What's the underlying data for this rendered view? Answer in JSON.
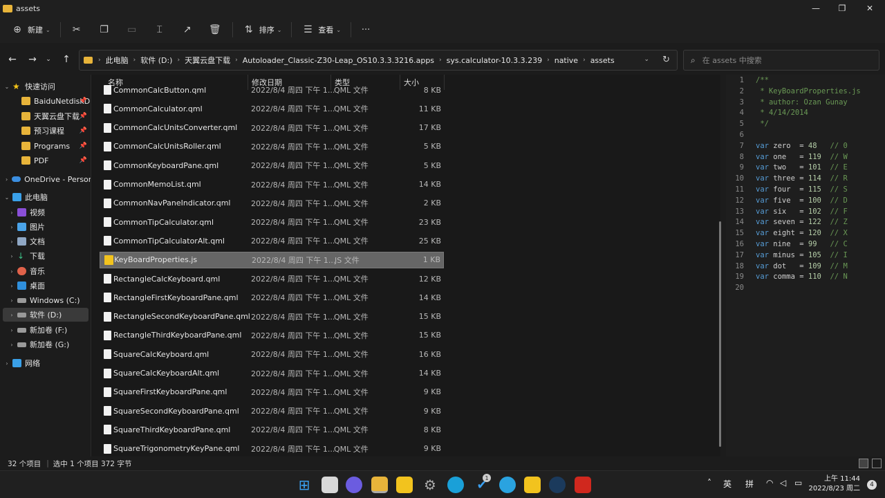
{
  "window": {
    "title": "assets",
    "minimize": "—",
    "maximize": "❐",
    "close": "✕"
  },
  "toolbar": {
    "new_label": "新建",
    "sort_label": "排序",
    "view_label": "查看",
    "more": "···"
  },
  "address": {
    "crumbs": [
      "此电脑",
      "软件 (D:)",
      "天翼云盘下载",
      "Autoloader_Classic-Z30-Leap_OS10.3.3.3216.apps",
      "sys.calculator-10.3.3.239",
      "native",
      "assets"
    ]
  },
  "search": {
    "placeholder": "在 assets 中搜索"
  },
  "sidebar": {
    "items": [
      {
        "label": "快速访问",
        "icon": "star-icon"
      },
      {
        "label": "BaiduNetdiskD",
        "icon": "folder-icon",
        "pinned": true
      },
      {
        "label": "天翼云盘下载",
        "icon": "folder-icon",
        "pinned": true
      },
      {
        "label": "预习课程",
        "icon": "folder-icon",
        "pinned": true
      },
      {
        "label": "Programs",
        "icon": "folder-icon",
        "pinned": true
      },
      {
        "label": "PDF",
        "icon": "folder-icon",
        "pinned": true
      },
      {
        "label": "OneDrive - Persona",
        "icon": "cloud-icon"
      },
      {
        "label": "此电脑",
        "icon": "pc-icon"
      },
      {
        "label": "视频",
        "icon": "video-icon"
      },
      {
        "label": "图片",
        "icon": "picture-icon"
      },
      {
        "label": "文档",
        "icon": "document-icon"
      },
      {
        "label": "下载",
        "icon": "download-icon"
      },
      {
        "label": "音乐",
        "icon": "music-icon"
      },
      {
        "label": "桌面",
        "icon": "desktop-icon"
      },
      {
        "label": "Windows (C:)",
        "icon": "drive-icon"
      },
      {
        "label": "软件 (D:)",
        "icon": "drive-icon",
        "selected": true
      },
      {
        "label": "新加卷 (F:)",
        "icon": "drive-icon"
      },
      {
        "label": "新加卷 (G:)",
        "icon": "drive-icon"
      },
      {
        "label": "网络",
        "icon": "network-icon"
      }
    ]
  },
  "columns": {
    "name": "名称",
    "date": "修改日期",
    "type": "类型",
    "size": "大小"
  },
  "files": [
    {
      "name": "CommonCalcButton.qml",
      "date": "2022/8/4 周四 下午 1...",
      "type": "QML 文件",
      "size": "8 KB"
    },
    {
      "name": "CommonCalculator.qml",
      "date": "2022/8/4 周四 下午 1...",
      "type": "QML 文件",
      "size": "11 KB"
    },
    {
      "name": "CommonCalcUnitsConverter.qml",
      "date": "2022/8/4 周四 下午 1...",
      "type": "QML 文件",
      "size": "17 KB"
    },
    {
      "name": "CommonCalcUnitsRoller.qml",
      "date": "2022/8/4 周四 下午 1...",
      "type": "QML 文件",
      "size": "5 KB"
    },
    {
      "name": "CommonKeyboardPane.qml",
      "date": "2022/8/4 周四 下午 1...",
      "type": "QML 文件",
      "size": "5 KB"
    },
    {
      "name": "CommonMemoList.qml",
      "date": "2022/8/4 周四 下午 1...",
      "type": "QML 文件",
      "size": "14 KB"
    },
    {
      "name": "CommonNavPaneIndicator.qml",
      "date": "2022/8/4 周四 下午 1...",
      "type": "QML 文件",
      "size": "2 KB"
    },
    {
      "name": "CommonTipCalculator.qml",
      "date": "2022/8/4 周四 下午 1...",
      "type": "QML 文件",
      "size": "23 KB"
    },
    {
      "name": "CommonTipCalculatorAlt.qml",
      "date": "2022/8/4 周四 下午 1...",
      "type": "QML 文件",
      "size": "25 KB"
    },
    {
      "name": "KeyBoardProperties.js",
      "date": "2022/8/4 周四 下午 1...",
      "type": "JS 文件",
      "size": "1 KB",
      "selected": true,
      "kind": "js"
    },
    {
      "name": "RectangleCalcKeyboard.qml",
      "date": "2022/8/4 周四 下午 1...",
      "type": "QML 文件",
      "size": "12 KB"
    },
    {
      "name": "RectangleFirstKeyboardPane.qml",
      "date": "2022/8/4 周四 下午 1...",
      "type": "QML 文件",
      "size": "14 KB"
    },
    {
      "name": "RectangleSecondKeyboardPane.qml",
      "date": "2022/8/4 周四 下午 1...",
      "type": "QML 文件",
      "size": "15 KB"
    },
    {
      "name": "RectangleThirdKeyboardPane.qml",
      "date": "2022/8/4 周四 下午 1...",
      "type": "QML 文件",
      "size": "15 KB"
    },
    {
      "name": "SquareCalcKeyboard.qml",
      "date": "2022/8/4 周四 下午 1...",
      "type": "QML 文件",
      "size": "16 KB"
    },
    {
      "name": "SquareCalcKeyboardAlt.qml",
      "date": "2022/8/4 周四 下午 1...",
      "type": "QML 文件",
      "size": "14 KB"
    },
    {
      "name": "SquareFirstKeyboardPane.qml",
      "date": "2022/8/4 周四 下午 1...",
      "type": "QML 文件",
      "size": "9 KB"
    },
    {
      "name": "SquareSecondKeyboardPane.qml",
      "date": "2022/8/4 周四 下午 1...",
      "type": "QML 文件",
      "size": "9 KB"
    },
    {
      "name": "SquareThirdKeyboardPane.qml",
      "date": "2022/8/4 周四 下午 1...",
      "type": "QML 文件",
      "size": "8 KB"
    },
    {
      "name": "SquareTrigonometryKeyPane.qml",
      "date": "2022/8/4 周四 下午 1...",
      "type": "QML 文件",
      "size": "9 KB"
    }
  ],
  "preview": {
    "lines": [
      {
        "n": "1",
        "t": "/**",
        "c": "cm"
      },
      {
        "n": "2",
        "t": " * KeyBoardProperties.js",
        "c": "cm"
      },
      {
        "n": "3",
        "t": " * author: Ozan Gunay",
        "c": "cm"
      },
      {
        "n": "4",
        "t": " * 4/14/2014",
        "c": "cm"
      },
      {
        "n": "5",
        "t": " */",
        "c": "cm"
      },
      {
        "n": "6",
        "t": "",
        "c": ""
      },
      {
        "n": "7",
        "kw": "var",
        "name": " zero  = ",
        "num": "48",
        "cm": "   // 0"
      },
      {
        "n": "8",
        "kw": "var",
        "name": " one   = ",
        "num": "119",
        "cm": "  // W"
      },
      {
        "n": "9",
        "kw": "var",
        "name": " two   = ",
        "num": "101",
        "cm": "  // E"
      },
      {
        "n": "10",
        "kw": "var",
        "name": " three = ",
        "num": "114",
        "cm": "  // R"
      },
      {
        "n": "11",
        "kw": "var",
        "name": " four  = ",
        "num": "115",
        "cm": "  // S"
      },
      {
        "n": "12",
        "kw": "var",
        "name": " five  = ",
        "num": "100",
        "cm": "  // D"
      },
      {
        "n": "13",
        "kw": "var",
        "name": " six   = ",
        "num": "102",
        "cm": "  // F"
      },
      {
        "n": "14",
        "kw": "var",
        "name": " seven = ",
        "num": "122",
        "cm": "  // Z"
      },
      {
        "n": "15",
        "kw": "var",
        "name": " eight = ",
        "num": "120",
        "cm": "  // X"
      },
      {
        "n": "16",
        "kw": "var",
        "name": " nine  = ",
        "num": "99",
        "cm": "   // C"
      },
      {
        "n": "17",
        "kw": "var",
        "name": " minus = ",
        "num": "105",
        "cm": "  // I"
      },
      {
        "n": "18",
        "kw": "var",
        "name": " dot   = ",
        "num": "109",
        "cm": "  // M"
      },
      {
        "n": "19",
        "kw": "var",
        "name": " comma = ",
        "num": "110",
        "cm": "  // N"
      },
      {
        "n": "20",
        "t": "",
        "c": ""
      }
    ]
  },
  "status": {
    "count": "32 个项目",
    "selection": "选中 1 个项目  372 字节"
  },
  "taskbar": {
    "ime_lang": "英",
    "ime_mode": "拼",
    "time": "上午 11:44",
    "date": "2022/8/23 周二",
    "notifications": "4",
    "badge": "1"
  },
  "colors": {
    "accent": "#e8b43a",
    "selection": "#666666",
    "comment": "#6a9955",
    "keyword": "#569cd6"
  }
}
